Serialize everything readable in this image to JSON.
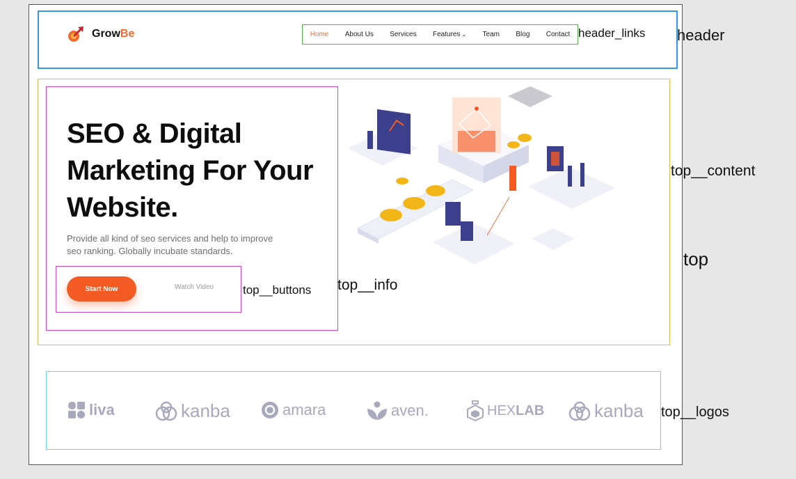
{
  "brand": {
    "name_part1": "Grow",
    "name_part2": "Be",
    "accent": "#f26a2e"
  },
  "nav": {
    "items": [
      {
        "label": "Home",
        "active": true
      },
      {
        "label": "About Us"
      },
      {
        "label": "Services"
      },
      {
        "label": "Features"
      },
      {
        "label": "Team"
      },
      {
        "label": "Blog"
      },
      {
        "label": "Contact"
      }
    ]
  },
  "hero": {
    "title_line1": "SEO & Digital",
    "title_line2": "Marketing For Your",
    "title_line3": "Website.",
    "desc_line1": "Provide all kind of seo services and help to improve",
    "desc_line2": "seo ranking. Globally incubate standards.",
    "start_label": "Start Now",
    "watch_label": "Watch Video",
    "start_color": "#f45a24"
  },
  "logos": [
    {
      "name": "liva",
      "icon": "flower-icon"
    },
    {
      "name": "kanba",
      "icon": "knot-icon"
    },
    {
      "name": "amara",
      "icon": "at-circle-icon"
    },
    {
      "name": "aven.",
      "icon": "leaf-heart-icon"
    },
    {
      "name_a": "HEX",
      "name_b": "LAB",
      "icon": "flask-hex-icon"
    },
    {
      "name": "kanba",
      "icon": "knot-icon"
    }
  ],
  "annotations": {
    "header_links": "header_links",
    "header": "header",
    "top_content": "top__content",
    "top": "top",
    "top_info": "top__info",
    "top_buttons": "top__buttons",
    "top_logos": "top__logos"
  }
}
